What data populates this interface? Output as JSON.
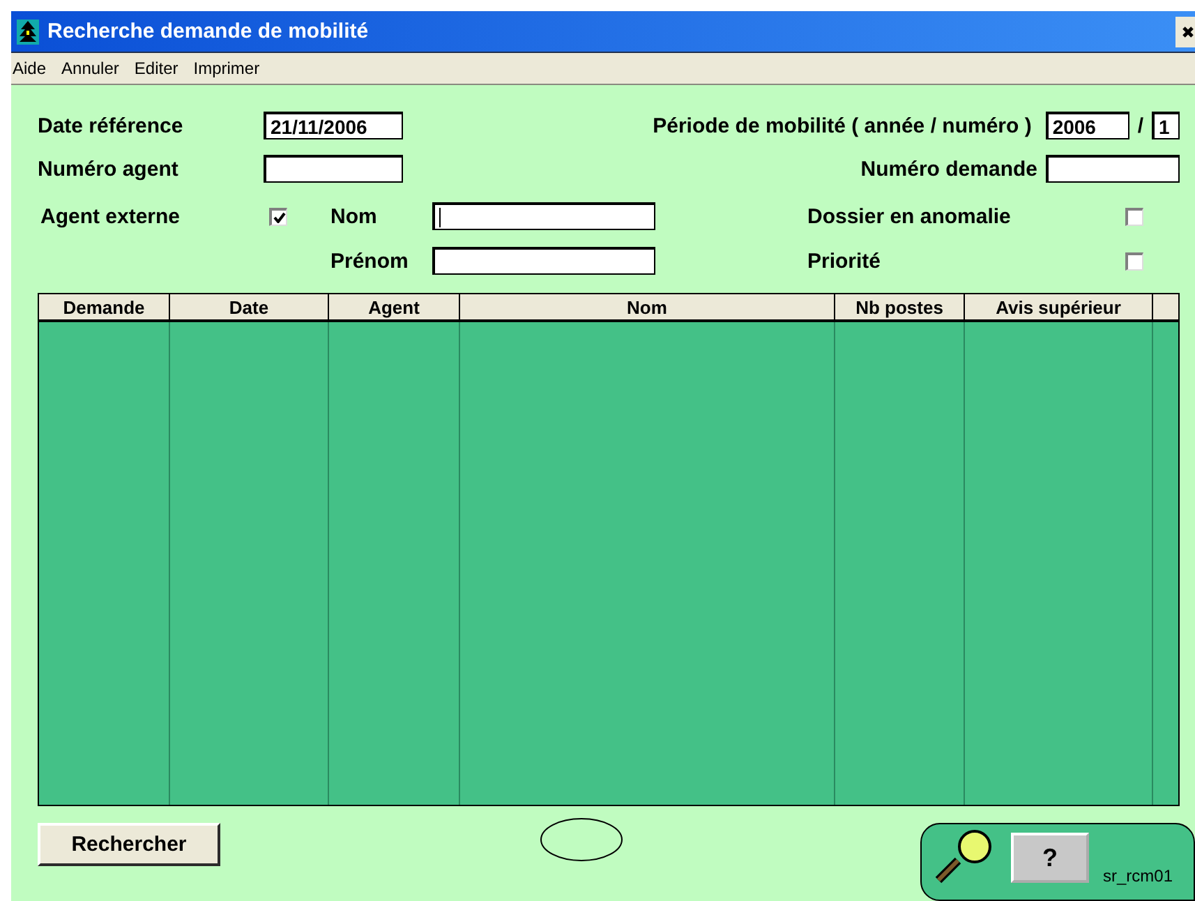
{
  "window": {
    "title": "Recherche demande de mobilité"
  },
  "menu": [
    "Aide",
    "Annuler",
    "Editer",
    "Imprimer"
  ],
  "form": {
    "date_reference": {
      "label": "Date référence",
      "value": "21/11/2006"
    },
    "periode": {
      "label": "Période de mobilité ( année / numéro )",
      "year": "2006",
      "separator": "/",
      "number": "1"
    },
    "numero_agent": {
      "label": "Numéro agent"
    },
    "numero_demande": {
      "label": "Numéro demande"
    },
    "agent_externe": {
      "label": "Agent externe",
      "checked": true
    },
    "nom": {
      "label": "Nom",
      "focused": true
    },
    "prenom": {
      "label": "Prénom"
    },
    "dossier_anomalie": {
      "label": "Dossier en anomalie",
      "checked": false
    },
    "priorite": {
      "label": "Priorité",
      "checked": false
    }
  },
  "table": {
    "columns": [
      "Demande",
      "Date",
      "Agent",
      "Nom",
      "Nb postes",
      "Avis supérieur"
    ]
  },
  "footer": {
    "search_button": "Rechercher",
    "help_button": "?",
    "code": "sr_rcm01"
  }
}
